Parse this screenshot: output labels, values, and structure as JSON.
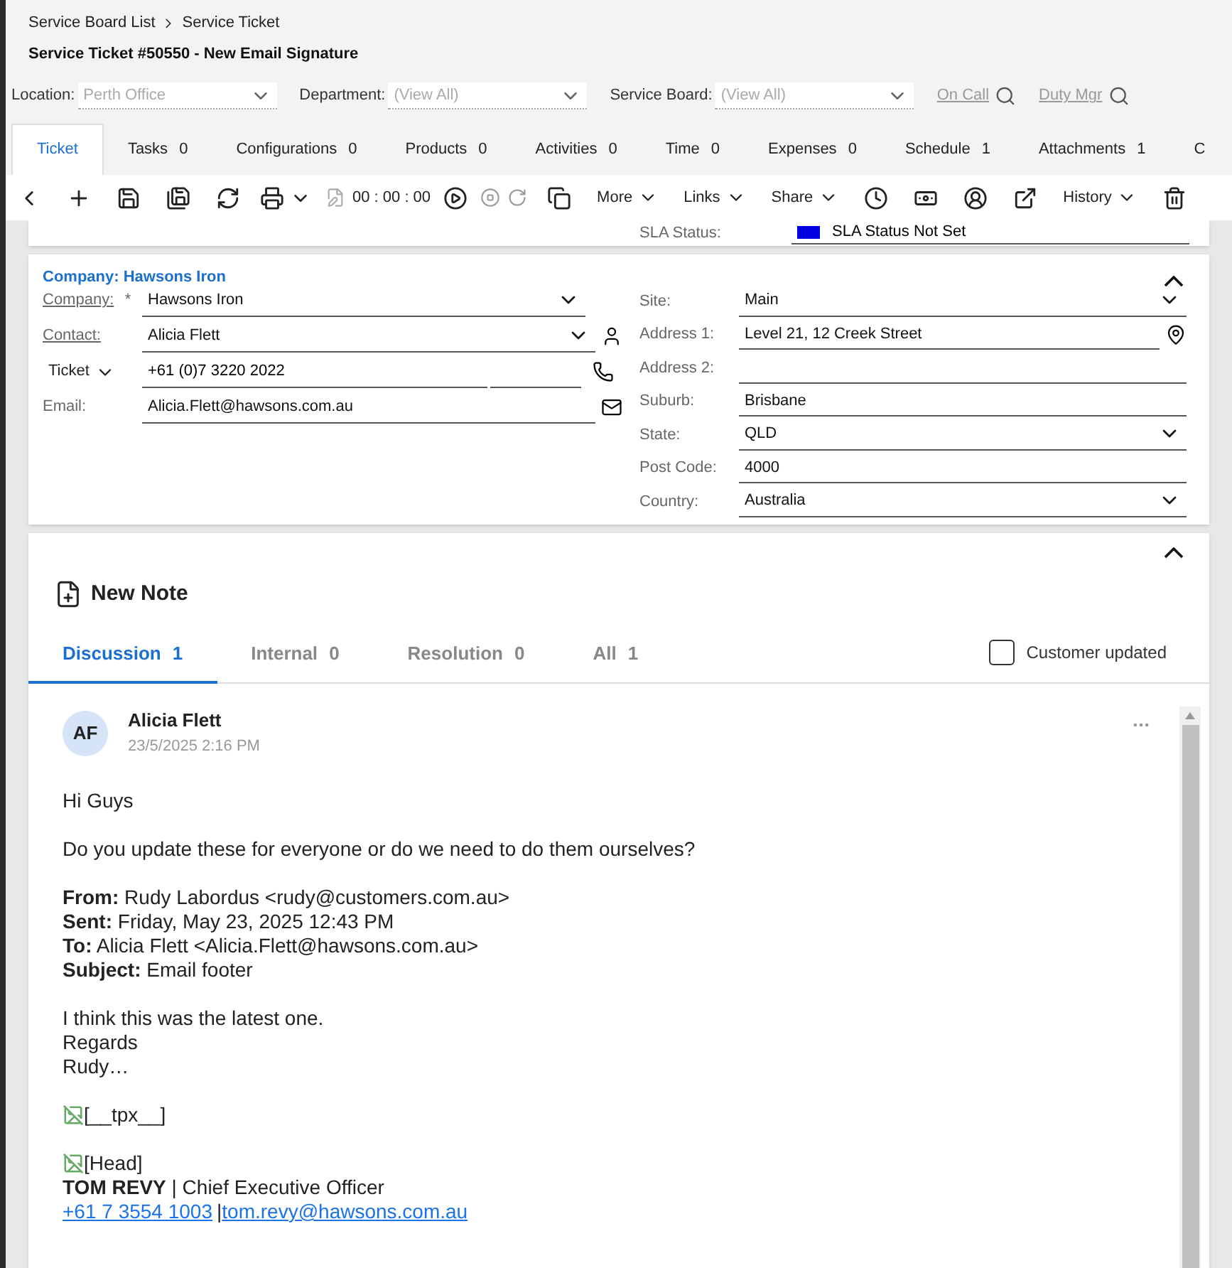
{
  "breadcrumb": [
    {
      "label": "Service Board List"
    },
    {
      "label": "Service Ticket"
    }
  ],
  "page_title": "Service Ticket #50550 - New Email Signature",
  "filters": [
    {
      "label": "Location:",
      "value": "Perth Office"
    },
    {
      "label": "Department:",
      "value": "(View All)"
    },
    {
      "label": "Service Board:",
      "value": "(View All)"
    }
  ],
  "lookups": [
    {
      "label": "On Call"
    },
    {
      "label": "Duty Mgr"
    }
  ],
  "tabs": [
    {
      "label": "Ticket",
      "selected": true
    },
    {
      "label": "Tasks",
      "count": "0",
      "selected": false
    },
    {
      "label": "Configurations",
      "count": "0",
      "selected": false
    },
    {
      "label": "Products",
      "count": "0",
      "selected": false
    },
    {
      "label": "Activities",
      "count": "0",
      "selected": false
    },
    {
      "label": "Time",
      "count": "0",
      "selected": false
    },
    {
      "label": "Expenses",
      "count": "0",
      "selected": false
    },
    {
      "label": "Schedule",
      "count": "1",
      "selected": false
    },
    {
      "label": "Attachments",
      "count": "1",
      "selected": false
    },
    {
      "label": "C",
      "selected": false
    }
  ],
  "toolbar": {
    "timer": "00 : 00 : 00",
    "menus": [
      "More",
      "Links",
      "Share"
    ],
    "history": "History"
  },
  "sla": {
    "label": "SLA Status:",
    "value": "SLA Status Not Set"
  },
  "company_card": {
    "title": "Company: Hawsons Iron",
    "expanded": true,
    "company": {
      "label": "Company:",
      "required": "*",
      "value": "Hawsons Iron"
    },
    "contact": {
      "label": "Contact:",
      "value": "Alicia Flett"
    },
    "phone": {
      "type": "Ticket",
      "value": "+61 (0)7 3220 2022"
    },
    "email": {
      "label": "Email:",
      "value": "Alicia.Flett@hawsons.com.au"
    },
    "address": [
      {
        "label": "Site:",
        "value": "Main",
        "kind": "select"
      },
      {
        "label": "Address 1:",
        "value": "Level 21, 12 Creek Street",
        "kind": "location"
      },
      {
        "label": "Address 2:",
        "kind": "text"
      },
      {
        "label": "Suburb:",
        "value": "Brisbane",
        "kind": "text"
      },
      {
        "label": "State:",
        "value": "QLD",
        "kind": "select"
      },
      {
        "label": "Post Code:",
        "value": "4000",
        "kind": "text"
      },
      {
        "label": "Country:",
        "value": "Australia",
        "kind": "select"
      }
    ]
  },
  "notes": {
    "expanded": true,
    "new_note": "New Note",
    "tabs": [
      {
        "label": "Discussion",
        "count": "1",
        "selected": true
      },
      {
        "label": "Internal",
        "count": "0",
        "selected": false
      },
      {
        "label": "Resolution",
        "count": "0",
        "selected": false
      },
      {
        "label": "All",
        "count": "1",
        "selected": false
      }
    ],
    "customer_updated": {
      "label": "Customer updated",
      "checked": false
    },
    "messages": [
      {
        "initials": "AF",
        "author": "Alicia Flett",
        "time": "23/5/2025 2:16 PM",
        "body": [
          {
            "kind": "text",
            "lines": [
              "Hi Guys"
            ]
          },
          {
            "kind": "text",
            "lines": [
              "Do you update these for everyone or do we need to do them ourselves?"
            ]
          },
          {
            "kind": "text",
            "lines": [
              "**From:** Rudy Labordus <rudy@customers.com.au>",
              "**Sent:** Friday, May 23, 2025 12:43 PM",
              "**To:** Alicia Flett <Alicia.Flett@hawsons.com.au>",
              "**Subject:** Email footer"
            ]
          },
          {
            "kind": "text",
            "lines": [
              "I think this was the latest one.",
              "Regards",
              "Rudy…"
            ]
          },
          {
            "kind": "image",
            "alt": "[__tpx__]"
          },
          {
            "kind": "signature",
            "image_alt": "[Head]",
            "title_line": "**TOM REVY** | Chief Executive Officer",
            "phone": "+61 7 3554 1003",
            "separator": "|",
            "email": "tom.revy@hawsons.com.au"
          }
        ]
      }
    ]
  }
}
